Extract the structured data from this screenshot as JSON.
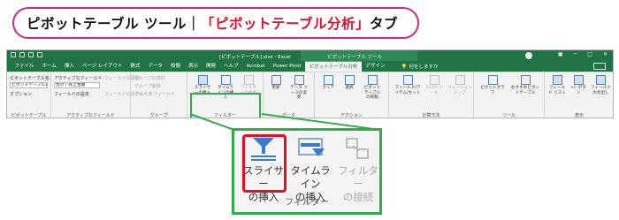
{
  "header": {
    "prefix": "ピボットテーブル ツール｜",
    "highlight": "「ピボットテーブル分析」",
    "suffix": "タブ"
  },
  "window": {
    "doc_title": "[ピボットテーブル].xlsx - Excel",
    "context_tab_label": "ピボットテーブル ツール"
  },
  "tabs": [
    "ファイル",
    "ホーム",
    "挿入",
    "ページ レイアウト",
    "数式",
    "データ",
    "校閲",
    "表示",
    "開発",
    "ヘルプ",
    "Acrobat",
    "Power Pivot",
    "ピボットテーブル分析",
    "デザイン"
  ],
  "active_tab": "ピボットテーブル分析",
  "tell_me": "何をしますか",
  "ribbon": {
    "pivot_name_label": "ピボットテーブル名:",
    "pivot_name_value": "ピボットテーブル1",
    "options": "オプション",
    "group_pivottable": "ピボットテーブル",
    "active_field_label": "アクティブなフィールド:",
    "active_field_value": "合計 / 売上金額",
    "field_settings": "フィールドの設定",
    "group_active_field": "アクティブなフィールド",
    "expand": "フィールドの展開",
    "collapse": "フィールドの折りたたみ",
    "group_sel": "グループの選択",
    "ungroup": "グループ解除",
    "group_field": "グループ フィールド",
    "group_group": "グループ",
    "slicer_small": "スライサーの挿入",
    "timeline_small": "タイムラインの挿入",
    "filter_conn_small": "フィルターの接続",
    "group_filter": "フィルター",
    "refresh": "更新",
    "change_source": "データ ソースの変更",
    "group_data": "データ",
    "clear": "クリア",
    "select": "選択",
    "move": "ピボットテーブルの移動",
    "group_action": "アクション",
    "fields_items": "フィールド/アイテム/セット",
    "olap": "OLAP ツール",
    "relations": "リレーションシップ",
    "group_calc": "計算方法",
    "pivotchart": "ピボットグラフ",
    "recommended": "おすすめピボットテーブル",
    "group_tools": "ツール",
    "field_list": "フィールド リスト",
    "plus_minus": "+/- ボタン",
    "field_headers": "フィールドの見出し",
    "group_show": "表示"
  },
  "zoom": {
    "slicer_line1": "スライサー",
    "slicer_line2": "の挿入",
    "timeline_line1": "タイムライン",
    "timeline_line2": "の挿入",
    "filter_line1": "フィルター",
    "filter_line2": "の接続",
    "group_label": "フィルター"
  },
  "colors": {
    "excel_green": "#217346",
    "highlight_green": "#33ad4b",
    "highlight_red": "#e0102a",
    "header_border": "#d6277f"
  }
}
